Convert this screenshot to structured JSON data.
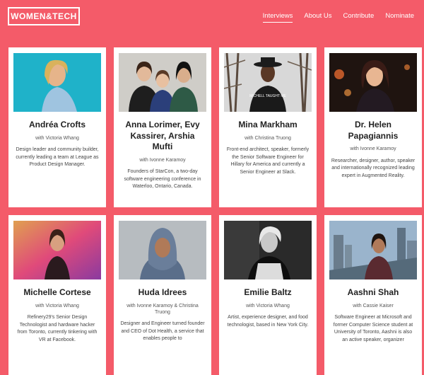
{
  "brand": {
    "logo_text": "WOMEN&TECH"
  },
  "nav": [
    {
      "label": "Interviews",
      "active": true
    },
    {
      "label": "About Us",
      "active": false
    },
    {
      "label": "Contribute",
      "active": false
    },
    {
      "label": "Nominate",
      "active": false
    }
  ],
  "cards": [
    {
      "name": "Andréa Crofts",
      "with": "with Victoria Whang",
      "bio": "Design leader and community builder, currently leading a team at League as Product Design Manager.",
      "photo": "portrait-smiling-blonde-on-teal"
    },
    {
      "name": "Anna Lorimer, Evy Kassirer, Arshia Mufti",
      "with": "with Ivonne Karamoy",
      "bio": "Founders of StarCon, a two-day software engineering conference in Waterloo, Ontario, Canada.",
      "photo": "three-women-group-photo"
    },
    {
      "name": "Mina Markham",
      "with": "with Christina Truong",
      "bio": "Front-end architect, speaker, formerly the Senior Software Engineer for Hillary for America and currently a Senior Engineer at Slack.",
      "photo": "woman-in-hat-snowy-trees",
      "shirt_text": "MICHELL TAUGHT ME"
    },
    {
      "name": "Dr. Helen Papagiannis",
      "with": "with Ivonne Karamoy",
      "bio": "Researcher, designer, author, speaker and internationally recognized leading expert in Augmented Reality.",
      "photo": "portrait-dark-hair-bokeh"
    },
    {
      "name": "Michelle Cortese",
      "with": "with Victoria Whang",
      "bio": "Refinery29's Senior Design Technologist and hardware hacker from Toronto, currently tinkering with VR at Facebook.",
      "photo": "portrait-orange-pink-backdrop"
    },
    {
      "name": "Huda Idrees",
      "with": "with Ivonne Karamoy & Christina Truong",
      "bio": "Designer and Engineer turned founder and CEO of Dot Health, a service that enables people to",
      "photo": "woman-in-hijab-grey"
    },
    {
      "name": "Emilie Baltz",
      "with": "with Victoria Whang",
      "bio": "Artist, experience designer, and food technologist, based in New York City.",
      "photo": "black-white-portrait"
    },
    {
      "name": "Aashni Shah",
      "with": "with Cassie Kaiser",
      "bio": "Software Engineer at Microsoft and former Computer Science student at University of Toronto, Aashni is also an active speaker, organizer",
      "photo": "woman-city-skyline"
    }
  ],
  "colors": {
    "background": "#f45b69",
    "card": "#ffffff"
  }
}
